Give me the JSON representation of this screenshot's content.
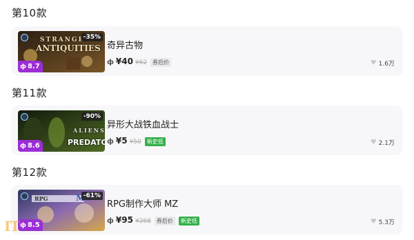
{
  "items": [
    {
      "section_title": "第10款",
      "thumb_title_1": "STRANGE",
      "thumb_title_2": "ANTIQUITIES",
      "discount": "-35%",
      "score": "8.7",
      "name": "奇异古物",
      "price_icon": "ф",
      "price": "¥40",
      "original_price": "¥62",
      "tag": "券后价",
      "tag_type": "gray",
      "likes": "1.6万",
      "colors": {
        "bg1": "#3a2a18",
        "bg2": "#6b4a22"
      }
    },
    {
      "section_title": "第11款",
      "thumb_title_1": "ALIENS",
      "thumb_title_2": "PREDATOR",
      "discount": "-90%",
      "score": "8.6",
      "name": "异形大战铁血战士",
      "price_icon": "ф",
      "price": "¥5",
      "original_price": "¥50",
      "tag": "新史低",
      "tag_type": "green",
      "likes": "2.1万",
      "colors": {
        "bg1": "#1e2a12",
        "bg2": "#4d6a22"
      }
    },
    {
      "section_title": "第12款",
      "thumb_title_1": "RPG",
      "thumb_title_2": "M",
      "discount": "-61%",
      "score": "8.5",
      "name": "RPG制作大师 MZ",
      "price_icon": "ф",
      "price": "¥95",
      "original_price": "¥268",
      "tag": "券后价",
      "tag2": "新史低",
      "tag_type": "gray",
      "likes": "5.3万",
      "colors": {
        "bg1": "#3a3a6a",
        "bg2": "#c9a24a"
      }
    }
  ],
  "icons": {
    "heart": "heart-icon",
    "steam": "steam-icon",
    "score": "flame-icon"
  },
  "watermark": "IT"
}
